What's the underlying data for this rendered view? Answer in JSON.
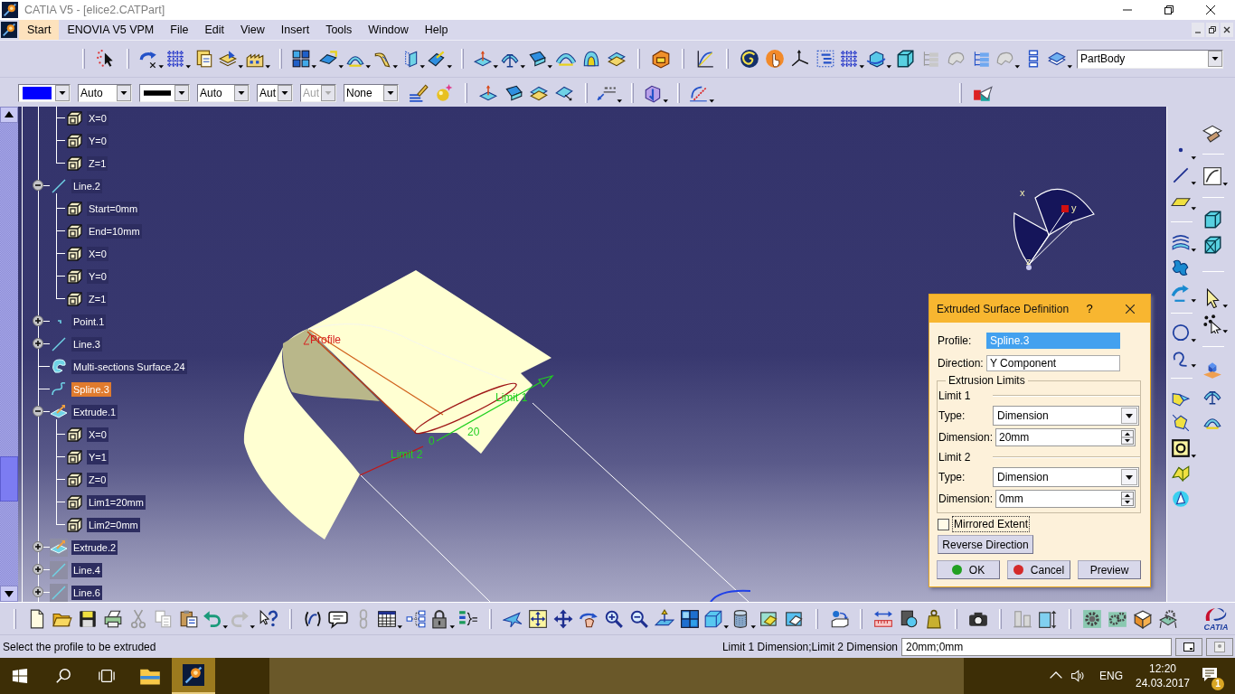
{
  "window": {
    "title": "CATIA V5 - [elice2.CATPart]"
  },
  "menu_bar": {
    "items": [
      {
        "label": "Start",
        "selected": true
      },
      {
        "label": "ENOVIA V5 VPM",
        "selected": false
      },
      {
        "label": "File",
        "selected": false
      },
      {
        "label": "Edit",
        "selected": false
      },
      {
        "label": "View",
        "selected": false
      },
      {
        "label": "Insert",
        "selected": false
      },
      {
        "label": "Tools",
        "selected": false
      },
      {
        "label": "Window",
        "selected": false
      },
      {
        "label": "Help",
        "selected": false
      }
    ]
  },
  "toolbar": {
    "current_body": "PartBody",
    "properties": [
      {
        "kind": "color",
        "color": "#0000ff",
        "disabled": false
      },
      {
        "kind": "text",
        "value": "Auto",
        "disabled": false
      },
      {
        "kind": "line",
        "color": "#000000",
        "disabled": false
      },
      {
        "kind": "text",
        "value": "Auto",
        "disabled": false
      },
      {
        "kind": "text",
        "value": "Aut",
        "disabled": false
      },
      {
        "kind": "text",
        "value": "Aut",
        "disabled": true
      },
      {
        "kind": "text",
        "value": "None",
        "disabled": false
      }
    ],
    "logo_text": "CATIA"
  },
  "tree": {
    "continued_children": [
      {
        "label": "X=0",
        "kind": "parameter",
        "selected": false,
        "hidden": false
      },
      {
        "label": "Y=0",
        "kind": "parameter",
        "selected": false,
        "hidden": false
      },
      {
        "label": "Z=1",
        "kind": "parameter",
        "selected": false,
        "hidden": false
      }
    ],
    "items": [
      {
        "label": "Line.2",
        "kind": "line",
        "expanded": true,
        "selected": false,
        "hidden": false,
        "children": [
          {
            "label": "Start=0mm",
            "kind": "parameter",
            "selected": false,
            "hidden": false
          },
          {
            "label": "End=10mm",
            "kind": "parameter",
            "selected": false,
            "hidden": false
          },
          {
            "label": "X=0",
            "kind": "parameter",
            "selected": false,
            "hidden": false
          },
          {
            "label": "Y=0",
            "kind": "parameter",
            "selected": false,
            "hidden": false
          },
          {
            "label": "Z=1",
            "kind": "parameter",
            "selected": false,
            "hidden": false
          }
        ]
      },
      {
        "label": "Point.1",
        "kind": "point",
        "expanded": false,
        "selected": false,
        "hidden": false
      },
      {
        "label": "Line.3",
        "kind": "line",
        "expanded": false,
        "selected": false,
        "hidden": false
      },
      {
        "label": "Multi-sections Surface.24",
        "kind": "surface",
        "selected": false,
        "hidden": false
      },
      {
        "label": "Spline.3",
        "kind": "spline",
        "selected": true,
        "hidden": false
      },
      {
        "label": "Extrude.1",
        "kind": "extrude",
        "expanded": true,
        "selected": false,
        "hidden": false,
        "children": [
          {
            "label": "X=0",
            "kind": "parameter",
            "selected": false,
            "hidden": false
          },
          {
            "label": "Y=1",
            "kind": "parameter",
            "selected": false,
            "hidden": false
          },
          {
            "label": "Z=0",
            "kind": "parameter",
            "selected": false,
            "hidden": false
          },
          {
            "label": "Lim1=20mm",
            "kind": "parameter",
            "selected": false,
            "hidden": false
          },
          {
            "label": "Lim2=0mm",
            "kind": "parameter",
            "selected": false,
            "hidden": false
          }
        ]
      },
      {
        "label": "Extrude.2",
        "kind": "extrude",
        "expanded": false,
        "selected": false,
        "hidden": true
      },
      {
        "label": "Line.4",
        "kind": "line",
        "expanded": false,
        "selected": false,
        "hidden": true
      },
      {
        "label": "Line.6",
        "kind": "line",
        "expanded": false,
        "selected": false,
        "hidden": true
      }
    ]
  },
  "viewport": {
    "annotations": [
      {
        "text": "Profile",
        "color": "#d82020"
      },
      {
        "text": "Limit 1",
        "color": "#22d022"
      },
      {
        "text": "Limit 2",
        "color": "#22d022"
      },
      {
        "text": "0",
        "color": "#22d022"
      },
      {
        "text": "20",
        "color": "#22d022"
      }
    ],
    "compass_axes": [
      "x",
      "y",
      "z"
    ]
  },
  "dialog": {
    "title": "Extruded Surface Definition",
    "help_label": "?",
    "fields": [
      {
        "label": "Profile:",
        "value": "Spline.3",
        "selected": true
      },
      {
        "label": "Direction:",
        "value": "Y Component",
        "selected": false
      }
    ],
    "limits_group": {
      "title": "Extrusion Limits",
      "limits": [
        {
          "heading": "Limit 1",
          "type_label": "Type:",
          "type_value": "Dimension",
          "dimension_label": "Dimension:",
          "dimension_value": "20mm"
        },
        {
          "heading": "Limit 2",
          "type_label": "Type:",
          "type_value": "Dimension",
          "dimension_label": "Dimension:",
          "dimension_value": "0mm"
        }
      ]
    },
    "mirrored_extent": {
      "label": "Mirrored Extent",
      "checked": false
    },
    "reverse_button": {
      "label": "Reverse Direction"
    },
    "buttons": [
      {
        "label": "OK",
        "color": "#22a022"
      },
      {
        "label": "Cancel",
        "color": "#d42a2a"
      },
      {
        "label": "Preview"
      }
    ]
  },
  "status_bar": {
    "message": "Select the profile to be extruded",
    "parameter_label": "Limit 1 Dimension;Limit 2 Dimension",
    "parameter_value": "20mm;0mm"
  },
  "taskbar": {
    "apps": [
      {
        "kind": "explorer",
        "selected": false
      },
      {
        "kind": "catia",
        "selected": true
      }
    ],
    "language": "ENG",
    "time": "12:20",
    "date": "24.03.2017",
    "notification_count": "1"
  }
}
